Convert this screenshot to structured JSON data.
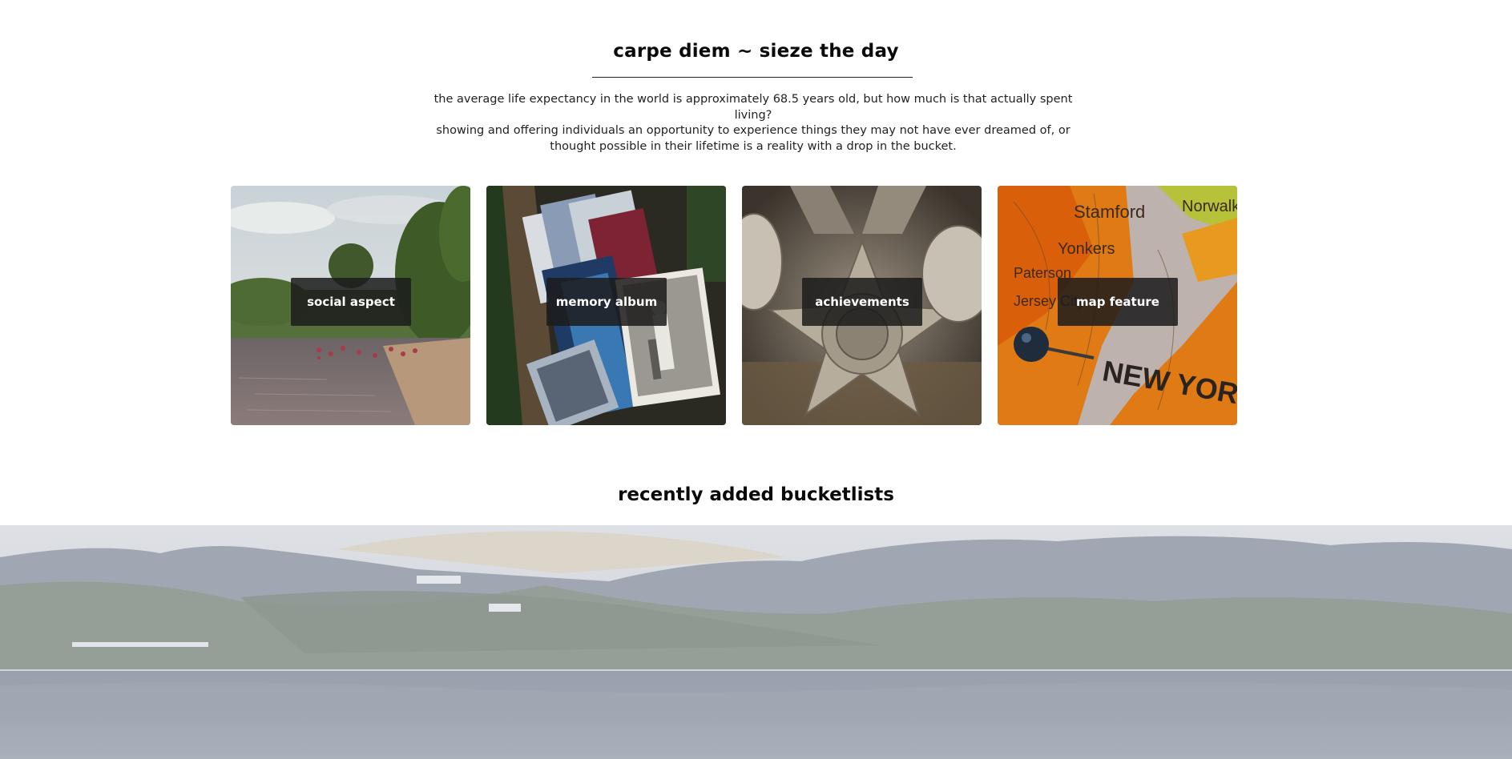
{
  "intro": {
    "title": "carpe diem ~ sieze the day",
    "lines": [
      "the average life expectancy in the world is approximately 68.5 years old, but how much is that actually spent living?",
      "showing and offering individuals an opportunity to experience things they may not have ever dreamed of, or",
      "thought possible in their lifetime is a reality with a drop in the bucket."
    ]
  },
  "features": [
    {
      "label": "social aspect",
      "image": "river-beach-photo"
    },
    {
      "label": "memory album",
      "image": "old-photographs-photo"
    },
    {
      "label": "achievements",
      "image": "war-medals-photo"
    },
    {
      "label": "map feature",
      "image": "new-york-map-pin-photo"
    }
  ],
  "recent": {
    "title": "recently added bucketlists",
    "banner_image": "mountain-lake-photo"
  },
  "map_photo_text": {
    "city": "NEW YORK",
    "places": [
      "Stamford",
      "Norwalk",
      "Yonkers",
      "Paterson",
      "Jersey City"
    ]
  },
  "colors": {
    "label_bg": "#1c1c1c",
    "banner_tint": "#c9ced8"
  }
}
